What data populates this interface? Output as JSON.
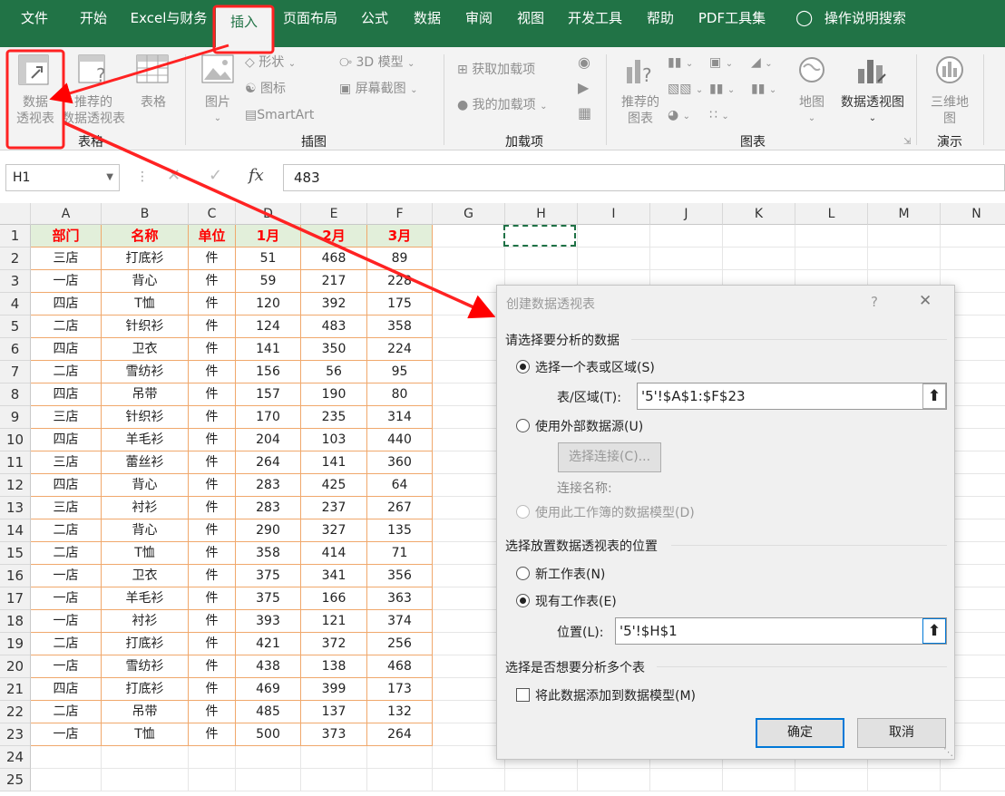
{
  "tabs": [
    "文件",
    "开始",
    "Excel与财务",
    "插入",
    "页面布局",
    "公式",
    "数据",
    "审阅",
    "视图",
    "开发工具",
    "帮助",
    "PDF工具集"
  ],
  "tell_me": "操作说明搜索",
  "ribbon": {
    "pivot_table": [
      "数据",
      "透视表"
    ],
    "recommended_pivot": [
      "推荐的",
      "数据透视表"
    ],
    "table": "表格",
    "group_tables": "表格",
    "pictures": "图片",
    "shapes": "形状",
    "icons": "图标",
    "smartart": "SmartArt",
    "models3d": "3D 模型",
    "screenshot": "屏幕截图",
    "group_illustrations": "插图",
    "get_addins": "获取加载项",
    "my_addins": "我的加载项",
    "group_addins": "加载项",
    "recommended_charts": [
      "推荐的",
      "图表"
    ],
    "maps": "地图",
    "pivot_chart": "数据透视图",
    "group_charts": "图表",
    "map3d": [
      "三维地",
      "图"
    ],
    "group_tours": "演示"
  },
  "formula_bar": {
    "name_box": "H1",
    "fx": "fx",
    "value": "483"
  },
  "columns": [
    "A",
    "B",
    "C",
    "D",
    "E",
    "F",
    "G",
    "H",
    "I",
    "J",
    "K",
    "L",
    "M",
    "N"
  ],
  "rows": [
    "1",
    "2",
    "3",
    "4",
    "5",
    "6",
    "7",
    "8",
    "9",
    "10",
    "11",
    "12",
    "13",
    "14",
    "15",
    "16",
    "17",
    "18",
    "19",
    "20",
    "21",
    "22",
    "23",
    "24",
    "25"
  ],
  "table_header": [
    "部门",
    "名称",
    "单位",
    "1月",
    "2月",
    "3月"
  ],
  "table_rows": [
    [
      "三店",
      "打底衫",
      "件",
      "51",
      "468",
      "89"
    ],
    [
      "一店",
      "背心",
      "件",
      "59",
      "217",
      "228"
    ],
    [
      "四店",
      "T恤",
      "件",
      "120",
      "392",
      "175"
    ],
    [
      "二店",
      "针织衫",
      "件",
      "124",
      "483",
      "358"
    ],
    [
      "四店",
      "卫衣",
      "件",
      "141",
      "350",
      "224"
    ],
    [
      "二店",
      "雪纺衫",
      "件",
      "156",
      "56",
      "95"
    ],
    [
      "四店",
      "吊带",
      "件",
      "157",
      "190",
      "80"
    ],
    [
      "三店",
      "针织衫",
      "件",
      "170",
      "235",
      "314"
    ],
    [
      "四店",
      "羊毛衫",
      "件",
      "204",
      "103",
      "440"
    ],
    [
      "三店",
      "蕾丝衫",
      "件",
      "264",
      "141",
      "360"
    ],
    [
      "四店",
      "背心",
      "件",
      "283",
      "425",
      "64"
    ],
    [
      "三店",
      "衬衫",
      "件",
      "283",
      "237",
      "267"
    ],
    [
      "二店",
      "背心",
      "件",
      "290",
      "327",
      "135"
    ],
    [
      "二店",
      "T恤",
      "件",
      "358",
      "414",
      "71"
    ],
    [
      "一店",
      "卫衣",
      "件",
      "375",
      "341",
      "356"
    ],
    [
      "一店",
      "羊毛衫",
      "件",
      "375",
      "166",
      "363"
    ],
    [
      "一店",
      "衬衫",
      "件",
      "393",
      "121",
      "374"
    ],
    [
      "二店",
      "打底衫",
      "件",
      "421",
      "372",
      "256"
    ],
    [
      "一店",
      "雪纺衫",
      "件",
      "438",
      "138",
      "468"
    ],
    [
      "四店",
      "打底衫",
      "件",
      "469",
      "399",
      "173"
    ],
    [
      "二店",
      "吊带",
      "件",
      "485",
      "137",
      "132"
    ],
    [
      "一店",
      "T恤",
      "件",
      "500",
      "373",
      "264"
    ]
  ],
  "dialog": {
    "title": "创建数据透视表",
    "help": "?",
    "close": "✕",
    "section1": "请选择要分析的数据",
    "opt_select_table": "选择一个表或区域(S)",
    "range_label": "表/区域(T):",
    "range_value": "'5'!$A$1:$F$23",
    "opt_external": "使用外部数据源(U)",
    "choose_connection": "选择连接(C)...",
    "connection_name": "连接名称:",
    "opt_data_model": "使用此工作簿的数据模型(D)",
    "section2": "选择放置数据透视表的位置",
    "opt_new_sheet": "新工作表(N)",
    "opt_existing_sheet": "现有工作表(E)",
    "location_label": "位置(L):",
    "location_value": "'5'!$H$1",
    "section3": "选择是否想要分析多个表",
    "add_to_model": "将此数据添加到数据模型(M)",
    "ok": "确定",
    "cancel": "取消"
  },
  "colors": {
    "excel_green": "#217346",
    "header_text": "#ff0000",
    "header_fill": "#e2efda",
    "table_border": "#f0a86c",
    "annotation": "#ff0000"
  }
}
